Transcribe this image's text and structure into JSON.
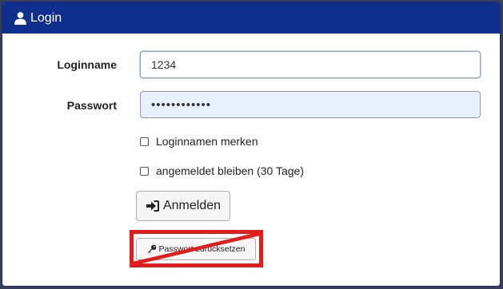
{
  "header": {
    "title": "Login",
    "icon": "user-icon",
    "color": "#0e2f8d"
  },
  "form": {
    "login_label": "Loginname",
    "login_value": "1234",
    "password_label": "Passwort",
    "password_value": "••••••••••••",
    "remember_label": "Loginnamen merken",
    "stay_label": "angemeldet bleiben (30 Tage)",
    "remember_checked": false,
    "stay_checked": false
  },
  "buttons": {
    "login_label": "Anmelden",
    "login_icon": "sign-in-icon",
    "reset_label": "Passwort zurücksetzen",
    "reset_icon": "key-icon"
  },
  "annotation": {
    "type": "red-crossed-box",
    "color": "#e31b1b"
  }
}
